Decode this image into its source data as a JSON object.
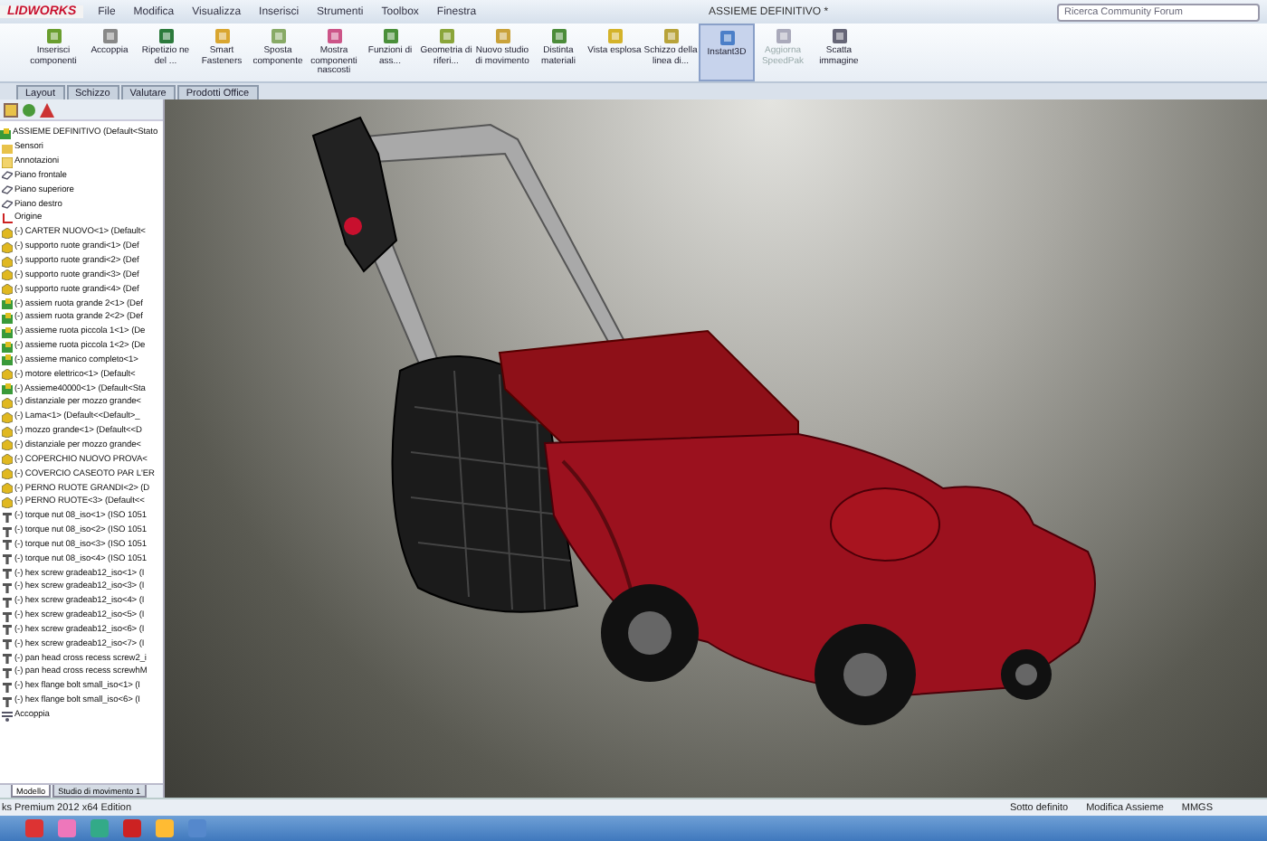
{
  "app": {
    "logo": "LIDWORKS",
    "menu": [
      "File",
      "Modifica",
      "Visualizza",
      "Inserisci",
      "Strumenti",
      "Toolbox",
      "Finestra"
    ],
    "title": "ASSIEME DEFINITIVO *",
    "search": {
      "placeholder": "Ricerca Community Forum"
    }
  },
  "ribbon": [
    {
      "label": "Inserisci componenti",
      "selected": false,
      "disabled": false
    },
    {
      "label": "Accoppia",
      "selected": false,
      "disabled": false
    },
    {
      "label": "Ripetizio ne del ...",
      "selected": false,
      "disabled": false
    },
    {
      "label": "Smart Fasteners",
      "selected": false,
      "disabled": false
    },
    {
      "label": "Sposta componente",
      "selected": false,
      "disabled": false
    },
    {
      "label": "Mostra componenti nascosti",
      "selected": false,
      "disabled": false
    },
    {
      "label": "Funzioni di ass...",
      "selected": false,
      "disabled": false
    },
    {
      "label": "Geometria di riferi...",
      "selected": false,
      "disabled": false
    },
    {
      "label": "Nuovo studio di movimento",
      "selected": false,
      "disabled": false
    },
    {
      "label": "Distinta materiali",
      "selected": false,
      "disabled": false
    },
    {
      "label": "Vista esplosa",
      "selected": false,
      "disabled": false
    },
    {
      "label": "Schizzo della linea di...",
      "selected": false,
      "disabled": false
    },
    {
      "label": "Instant3D",
      "selected": true,
      "disabled": false
    },
    {
      "label": "Aggiorna SpeedPak",
      "selected": false,
      "disabled": true
    },
    {
      "label": "Scatta immagine",
      "selected": false,
      "disabled": false
    }
  ],
  "tabs": [
    {
      "label": "Layout",
      "selected": false
    },
    {
      "label": "Schizzo",
      "selected": false
    },
    {
      "label": "Valutare",
      "selected": false
    },
    {
      "label": "Prodotti Office",
      "selected": false
    }
  ],
  "tree": {
    "label": "ASSIEME DEFINITIVO  (Default<Stato",
    "children": [
      {
        "kind": "folder",
        "label": "Sensori"
      },
      {
        "kind": "annotation",
        "label": "Annotazioni"
      },
      {
        "kind": "plane",
        "label": "Piano frontale"
      },
      {
        "kind": "plane",
        "label": "Piano superiore"
      },
      {
        "kind": "plane",
        "label": "Piano destro"
      },
      {
        "kind": "origin",
        "label": "Origine"
      },
      {
        "kind": "part",
        "label": "(-) CARTER NUOVO<1> (Default<"
      },
      {
        "kind": "part",
        "label": "(-) supporto ruote grandi<1> (Def"
      },
      {
        "kind": "part",
        "label": "(-) supporto ruote grandi<2> (Def"
      },
      {
        "kind": "part",
        "label": "(-) supporto ruote grandi<3> (Def"
      },
      {
        "kind": "part",
        "label": "(-) supporto ruote grandi<4> (Def"
      },
      {
        "kind": "assembly",
        "label": "(-) assiem ruota grande 2<1> (Def"
      },
      {
        "kind": "assembly",
        "label": "(-) assiem ruota grande 2<2> (Def"
      },
      {
        "kind": "assembly",
        "label": "(-) assieme ruota piccola 1<1> (De"
      },
      {
        "kind": "assembly",
        "label": "(-) assieme ruota piccola 1<2> (De"
      },
      {
        "kind": "assembly",
        "label": "(-) assieme manico completo<1>"
      },
      {
        "kind": "part",
        "label": "(-) motore elettrico<1> (Default<"
      },
      {
        "kind": "assembly",
        "label": "(-) Assieme40000<1> (Default<Sta"
      },
      {
        "kind": "part",
        "label": "(-) distanziale per mozzo grande<"
      },
      {
        "kind": "part",
        "label": "(-) Lama<1> (Default<<Default>_"
      },
      {
        "kind": "part",
        "label": "(-) mozzo grande<1> (Default<<D"
      },
      {
        "kind": "part",
        "label": "(-) distanziale per mozzo grande<"
      },
      {
        "kind": "part",
        "label": "(-) COPERCHIO NUOVO PROVA<"
      },
      {
        "kind": "part",
        "label": "(-) COVERCIO CASEOTO PAR L'ER"
      },
      {
        "kind": "part",
        "label": "(-) PERNO RUOTE GRANDI<2> (D"
      },
      {
        "kind": "part",
        "label": "(-) PERNO RUOTE<3> (Default<<"
      },
      {
        "kind": "fastener",
        "label": "(-) torque nut 08_iso<1> (ISO 1051"
      },
      {
        "kind": "fastener",
        "label": "(-) torque nut 08_iso<2> (ISO 1051"
      },
      {
        "kind": "fastener",
        "label": "(-) torque nut 08_iso<3> (ISO 1051"
      },
      {
        "kind": "fastener",
        "label": "(-) torque nut 08_iso<4> (ISO 1051"
      },
      {
        "kind": "fastener",
        "label": "(-) hex screw gradeab12_iso<1> (I"
      },
      {
        "kind": "fastener",
        "label": "(-) hex screw gradeab12_iso<3> (I"
      },
      {
        "kind": "fastener",
        "label": "(-) hex screw gradeab12_iso<4> (I"
      },
      {
        "kind": "fastener",
        "label": "(-) hex screw gradeab12_iso<5> (I"
      },
      {
        "kind": "fastener",
        "label": "(-) hex screw gradeab12_iso<6> (I"
      },
      {
        "kind": "fastener",
        "label": "(-) hex screw gradeab12_iso<7> (I"
      },
      {
        "kind": "fastener",
        "label": "(-) pan head cross recess screw2_i"
      },
      {
        "kind": "fastener",
        "label": "(-) pan head cross recess screwhM"
      },
      {
        "kind": "fastener",
        "label": "(-) hex flange bolt small_iso<1> (I"
      },
      {
        "kind": "fastener",
        "label": "(-) hex flange bolt small_iso<6> (I"
      },
      {
        "kind": "mates",
        "label": "Accoppia"
      }
    ]
  },
  "panel_tabs": [
    {
      "label": "Modello",
      "selected": true
    },
    {
      "label": "Studio di movimento 1",
      "selected": false
    }
  ],
  "status_bar": {
    "edition": "ks Premium 2012 x64 Edition",
    "items": [
      "Sotto definito",
      "Modifica Assieme",
      "MMGS"
    ]
  }
}
